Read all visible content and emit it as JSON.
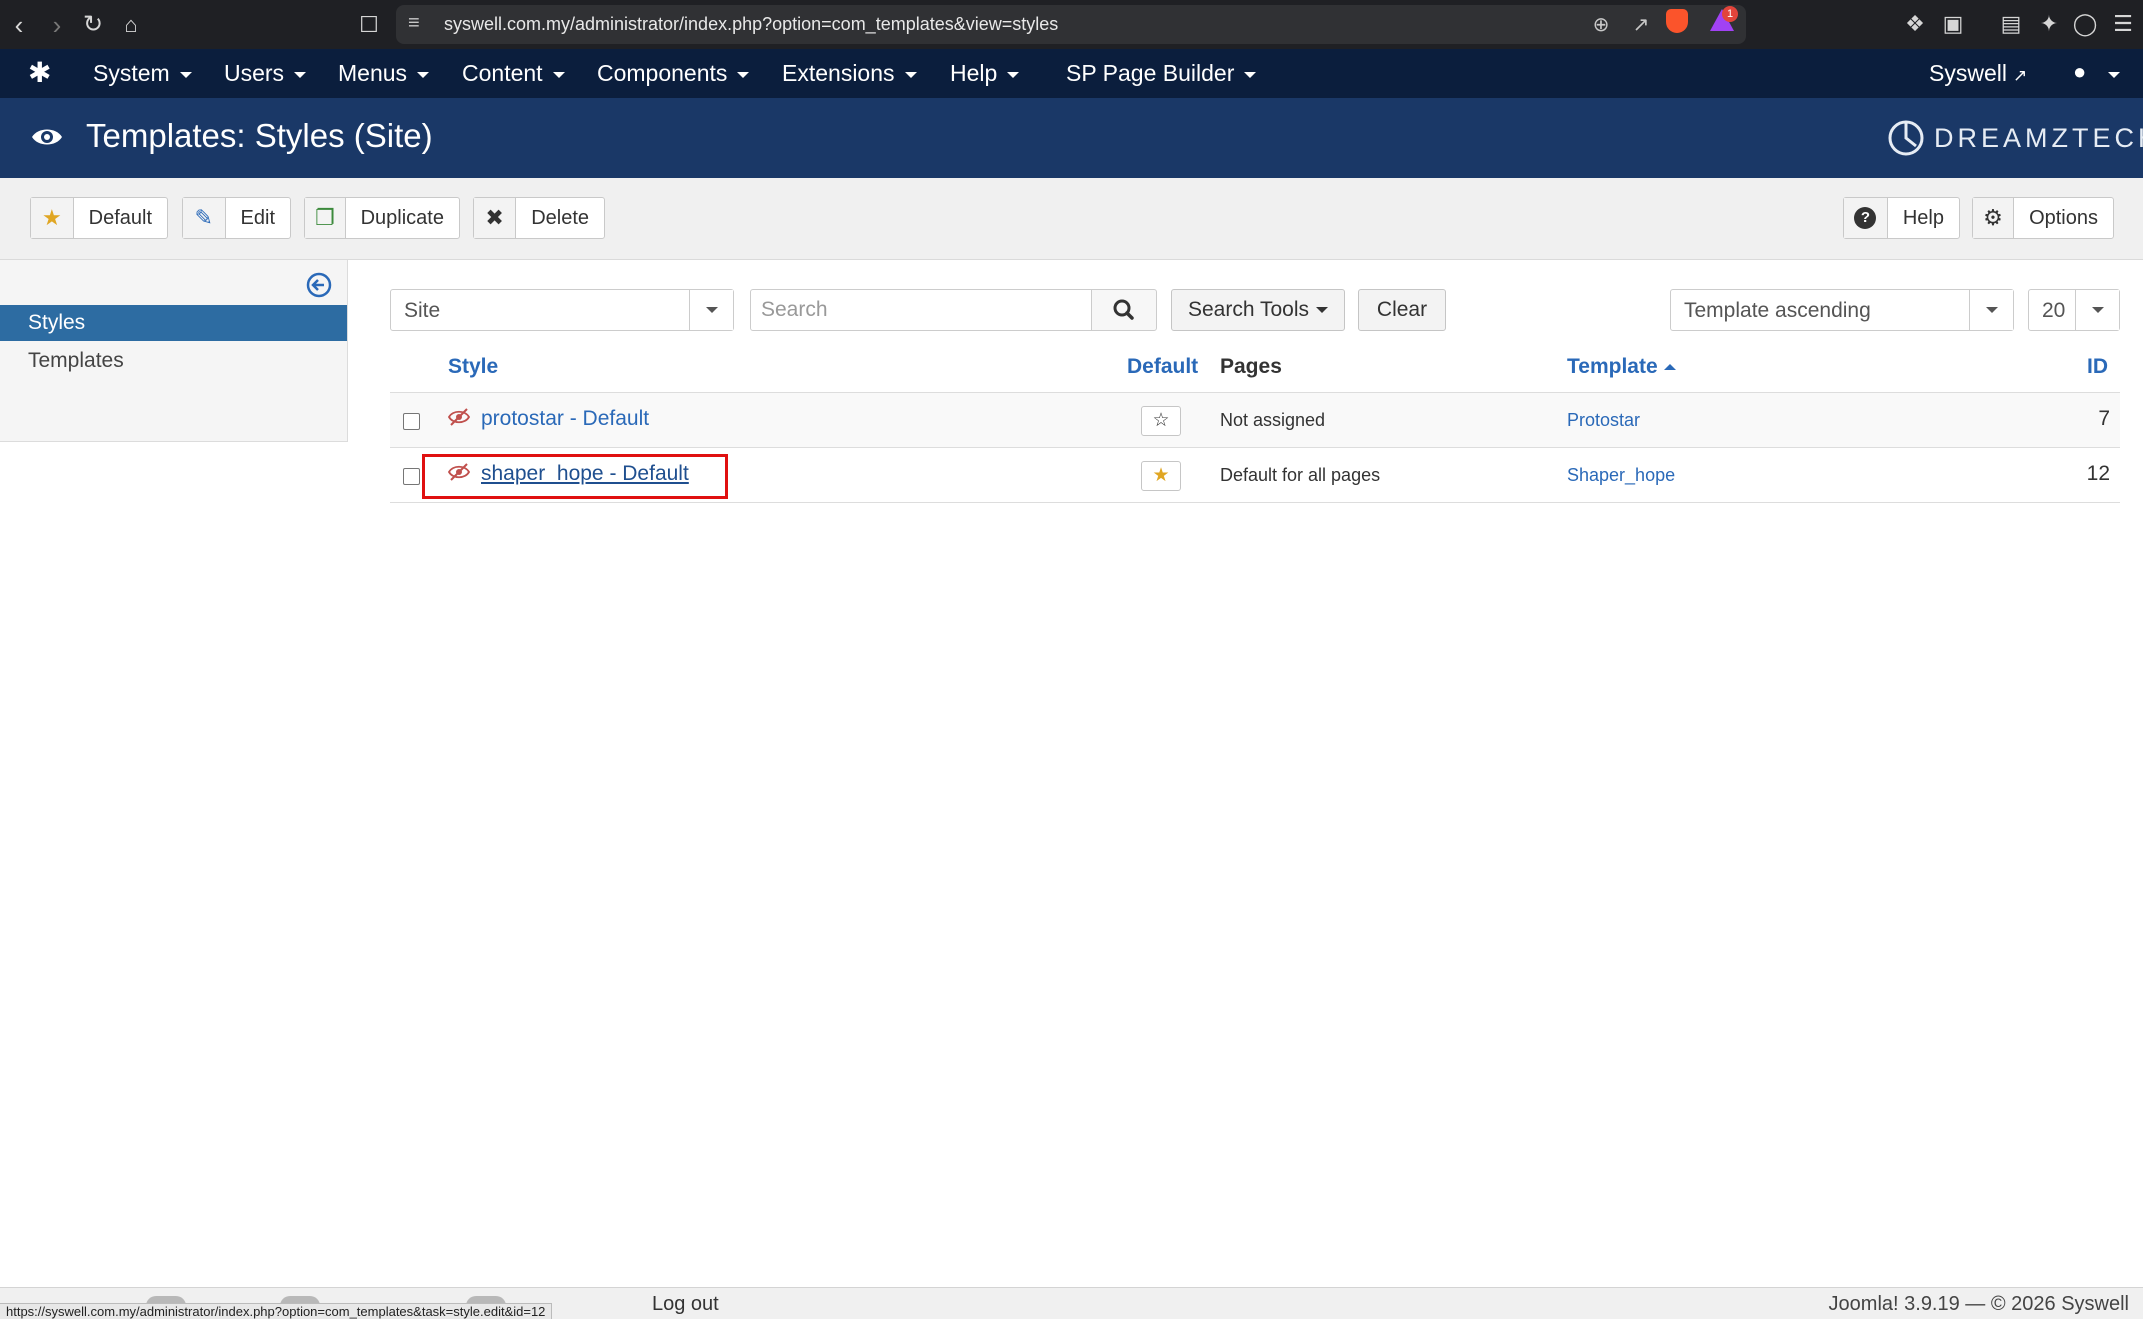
{
  "browser": {
    "url": "syswell.com.my/administrator/index.php?option=com_templates&view=styles",
    "status_url": "https://syswell.com.my/administrator/index.php?option=com_templates&task=style.edit&id=12",
    "rewards_badge": "1"
  },
  "topnav": {
    "menus": [
      "System",
      "Users",
      "Menus",
      "Content",
      "Components",
      "Extensions",
      "Help",
      "SP Page Builder"
    ],
    "site_link": "Syswell"
  },
  "header": {
    "title": "Templates: Styles (Site)",
    "brand": "DREAMZTECH"
  },
  "toolbar": {
    "default_label": "Default",
    "edit_label": "Edit",
    "duplicate_label": "Duplicate",
    "delete_label": "Delete",
    "help_label": "Help",
    "options_label": "Options"
  },
  "sidebar": {
    "items": [
      {
        "label": "Styles",
        "active": true
      },
      {
        "label": "Templates",
        "active": false
      }
    ]
  },
  "filters": {
    "client_value": "Site",
    "search_placeholder": "Search",
    "search_tools_label": "Search Tools",
    "clear_label": "Clear",
    "ordering_value": "Template ascending",
    "limit_value": "20"
  },
  "table": {
    "headers": {
      "style": "Style",
      "default": "Default",
      "pages": "Pages",
      "template": "Template",
      "id": "ID"
    },
    "rows": [
      {
        "style": "protostar - Default",
        "is_default": false,
        "pages": "Not assigned",
        "template": "Protostar",
        "id": "7"
      },
      {
        "style": "shaper_hope - Default",
        "is_default": true,
        "pages": "Default for all pages",
        "template": "Shaper_hope",
        "id": "12"
      }
    ]
  },
  "footer": {
    "logout_label": "Log out",
    "copyright": "Joomla! 3.9.19 — © 2026 Syswell"
  },
  "colors": {
    "topnav_bg": "#0b1e3d",
    "header_bg": "#1a3867",
    "link": "#2a69b8",
    "active_sidebar": "#2d6ca2",
    "star": "#e0a623",
    "highlight": "#e01010"
  }
}
